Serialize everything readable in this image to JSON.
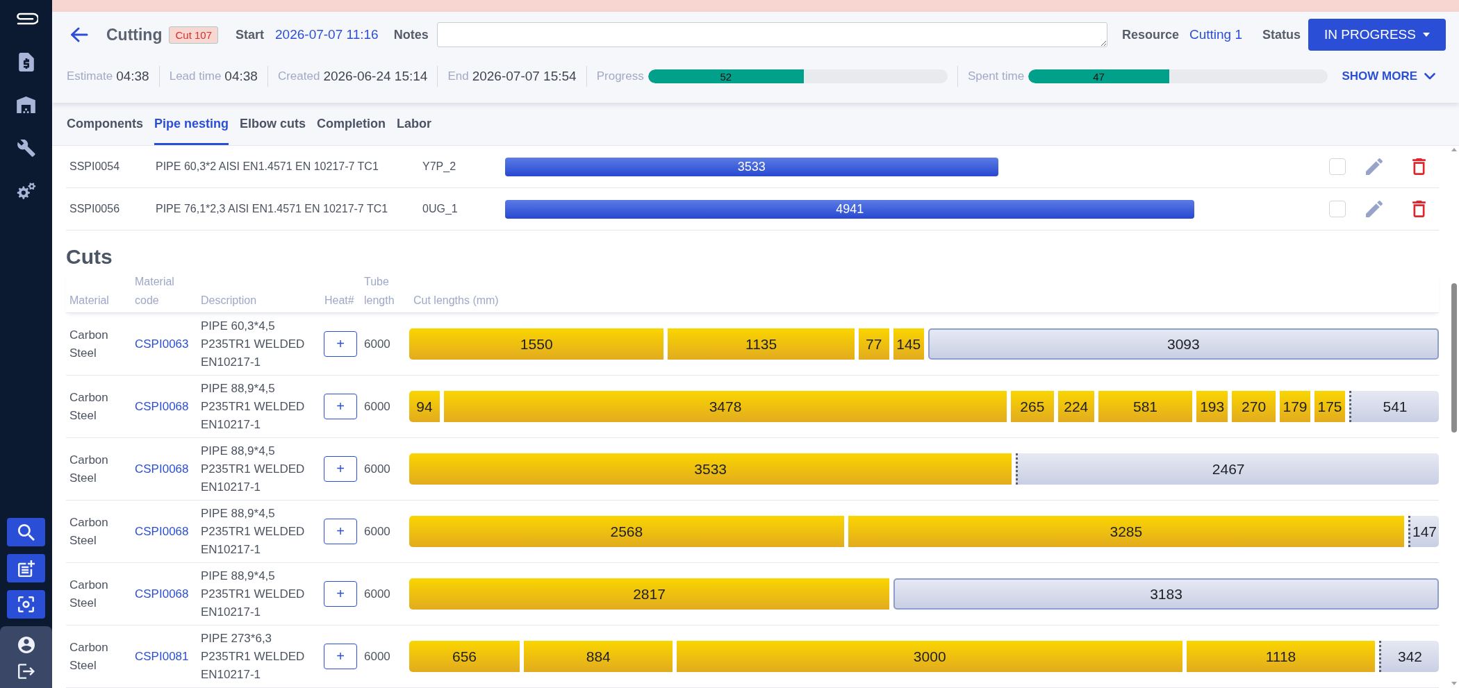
{
  "header": {
    "title": "Cutting",
    "badge": "Cut 107",
    "start": {
      "label": "Start",
      "value": "2026-07-07 11:16"
    },
    "notes": {
      "label": "Notes"
    },
    "resource": {
      "label": "Resource",
      "value": "Cutting 1"
    },
    "status": {
      "label": "Status",
      "value": "IN PROGRESS"
    },
    "details": [
      {
        "label": "Estimate",
        "value": "04:38"
      },
      {
        "label": "Lead time",
        "value": "04:38"
      },
      {
        "label": "Created",
        "value": "2026-06-24 15:14"
      },
      {
        "label": "End",
        "value": "2026-07-07 15:54"
      }
    ],
    "meters": [
      {
        "label": "Progress",
        "reading": "52",
        "level": 0.52
      },
      {
        "label": "Spent time",
        "reading": "47",
        "level": 0.47
      }
    ],
    "show_more": "SHOW MORE"
  },
  "tabs": [
    {
      "label": "Components",
      "selected": false
    },
    {
      "label": "Pipe nesting",
      "selected": true
    },
    {
      "label": "Elbow cuts",
      "selected": false
    },
    {
      "label": "Completion",
      "selected": false
    },
    {
      "label": "Labor",
      "selected": false
    }
  ],
  "pipe_nesting": {
    "rows": [
      {
        "code": "SSPI0054",
        "description": "PIPE 60,3*2 AISI EN1.4571 EN 10217-7 TC1",
        "heat": "Y7P_2",
        "length": "3533",
        "checked": false
      },
      {
        "code": "SSPI0056",
        "description": "PIPE 76,1*2,3 AISI EN1.4571 EN 10217-7 TC1",
        "heat": "0UG_1",
        "length": "4941",
        "checked": false
      }
    ]
  },
  "cuts": {
    "title": "Cuts",
    "columns": [
      "Material",
      "Material code",
      "Description",
      "Heat#",
      "Tube length",
      "Cut lengths (mm)"
    ],
    "rows": [
      {
        "material": "Carbon Steel",
        "code": "CSPI0063",
        "description": "PIPE 60,3*4,5 P235TR1 WELDED EN10217-1",
        "heat_button": "+",
        "tube_length": "6000",
        "segments": [
          {
            "kind": "cut",
            "value": "1550"
          },
          {
            "kind": "cut",
            "value": "1135"
          },
          {
            "kind": "cut",
            "value": "77"
          },
          {
            "kind": "cut",
            "value": "145"
          },
          {
            "kind": "remnant",
            "value": "3093"
          }
        ]
      },
      {
        "material": "Carbon Steel",
        "code": "CSPI0068",
        "description": "PIPE 88,9*4,5 P235TR1 WELDED EN10217-1",
        "heat_button": "+",
        "tube_length": "6000",
        "segments": [
          {
            "kind": "cut",
            "value": "94"
          },
          {
            "kind": "cut",
            "value": "3478"
          },
          {
            "kind": "cut",
            "value": "265"
          },
          {
            "kind": "cut",
            "value": "224"
          },
          {
            "kind": "cut",
            "value": "581"
          },
          {
            "kind": "cut",
            "value": "193"
          },
          {
            "kind": "cut",
            "value": "270"
          },
          {
            "kind": "cut",
            "value": "179"
          },
          {
            "kind": "cut",
            "value": "175"
          },
          {
            "kind": "waste",
            "value": "541"
          }
        ]
      },
      {
        "material": "Carbon Steel",
        "code": "CSPI0068",
        "description": "PIPE 88,9*4,5 P235TR1 WELDED EN10217-1",
        "heat_button": "+",
        "tube_length": "6000",
        "segments": [
          {
            "kind": "cut",
            "value": "3533"
          },
          {
            "kind": "waste",
            "value": "2467"
          }
        ]
      },
      {
        "material": "Carbon Steel",
        "code": "CSPI0068",
        "description": "PIPE 88,9*4,5 P235TR1 WELDED EN10217-1",
        "heat_button": "+",
        "tube_length": "6000",
        "segments": [
          {
            "kind": "cut",
            "value": "2568"
          },
          {
            "kind": "cut",
            "value": "3285"
          },
          {
            "kind": "waste",
            "value": "147"
          }
        ]
      },
      {
        "material": "Carbon Steel",
        "code": "CSPI0068",
        "description": "PIPE 88,9*4,5 P235TR1 WELDED EN10217-1",
        "heat_button": "+",
        "tube_length": "6000",
        "segments": [
          {
            "kind": "cut",
            "value": "2817"
          },
          {
            "kind": "remnant",
            "value": "3183"
          }
        ]
      },
      {
        "material": "Carbon Steel",
        "code": "CSPI0081",
        "description": "PIPE 273*6,3 P235TR1 WELDED EN10217-1",
        "heat_button": "+",
        "tube_length": "6000",
        "segments": [
          {
            "kind": "cut",
            "value": "656"
          },
          {
            "kind": "cut",
            "value": "884"
          },
          {
            "kind": "cut",
            "value": "3000"
          },
          {
            "kind": "cut",
            "value": "1118"
          },
          {
            "kind": "waste",
            "value": "342"
          }
        ]
      }
    ]
  }
}
